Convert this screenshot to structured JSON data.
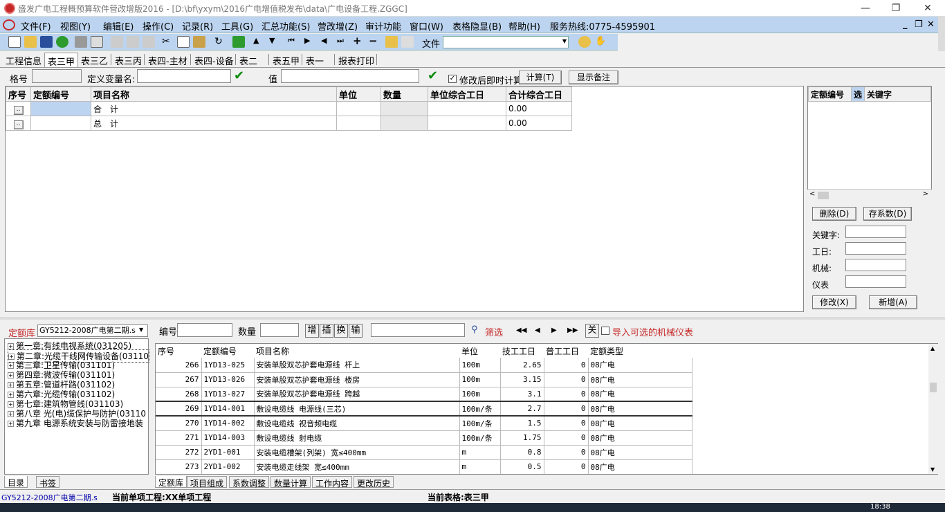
{
  "window": {
    "title": "盛发广电工程概预算软件营改增版2016 - [D:\\bf\\yxym\\2016广电增值税发布\\data\\广电设备工程.ZGGC]",
    "minimize": "—",
    "restore": "❐",
    "close": "✕"
  },
  "menu": [
    "文件(F)",
    "视图(Y)",
    "编辑(E)",
    "操作(C)",
    "记录(R)",
    "工具(G)",
    "汇总功能(S)",
    "营改增(Z)",
    "审计功能",
    "窗口(W)",
    "表格隐显(B)",
    "帮助(H)",
    "服务热线:0775-4595901"
  ],
  "toolbar": {
    "file_label": "文件"
  },
  "tabs": [
    "工程信息",
    "表三甲",
    "表三乙",
    "表三丙",
    "表四-主材",
    "表四-设备",
    "表二",
    "表五甲",
    "表一",
    "报表打印"
  ],
  "active_tab": "表三甲",
  "params": {
    "ge_label": "格号",
    "define_var_label": "定义变量名:",
    "value_label": "值",
    "recalc_label": "修改后即时计算",
    "calc_button": "计算(T)",
    "show_note_button": "显示备注"
  },
  "main_grid": {
    "columns": [
      "序号",
      "定额编号",
      "项目名称",
      "单位",
      "数量",
      "单位综合工日",
      "合计综合工日"
    ],
    "rows": [
      {
        "btn": "..",
        "name": "合　计",
        "total": "0.00"
      },
      {
        "btn": "..",
        "name": "总　计",
        "total": "0.00"
      }
    ]
  },
  "right_panel": {
    "columns": [
      "定额编号",
      "选",
      "关键字"
    ],
    "delete_button": "删除(D)",
    "save_coef_button": "存系数(D)",
    "keyword_label": "关键字:",
    "workday_label": "工日:",
    "machine_label": "机械:",
    "instrument_label": "仪表",
    "modify_button": "修改(X)",
    "add_button": "新增(A)"
  },
  "library": {
    "label": "定额库",
    "selected": "GY5212-2008广电第二期.s",
    "tree": [
      "第一章:有线电视系统(031205)",
      "第二章:光缆干线网传输设备(03110",
      "第三章:卫星传输(031101)",
      "第四章:微波传输(031101)",
      "第五章:管道杆路(031102)",
      "第六章:光缆传输(031102)",
      "第七章:建筑物管线(031103)",
      "第八章 光(电)缆保护与防护(03110",
      "第九章 电源系统安装与防雷接地装"
    ],
    "tabs": [
      "目录",
      "书签"
    ]
  },
  "search": {
    "code_label": "编号",
    "qty_label": "数量",
    "add": "增",
    "insert": "插",
    "swap": "换",
    "input": "输",
    "filter_label": "筛选",
    "first": "◀◀",
    "prev": "◀",
    "next": "▶",
    "last": "▶▶",
    "close": "关",
    "import_label": "导入可选的机械仪表"
  },
  "rate_table": {
    "columns": [
      "序号",
      "定额编号",
      "项目名称",
      "单位",
      "技工工日",
      "普工工日",
      "定额类型"
    ],
    "rows": [
      [
        "266",
        "1YD13-025",
        "安装单股双芯护套电源线 杆上",
        "100m",
        "2.65",
        "0",
        "08广电"
      ],
      [
        "267",
        "1YD13-026",
        "安装单股双芯护套电源线 楼房",
        "100m",
        "3.15",
        "0",
        "08广电"
      ],
      [
        "268",
        "1YD13-027",
        "安装单股双芯护套电源线 跨越",
        "100m",
        "3.1",
        "0",
        "08广电"
      ],
      [
        "269",
        "1YD14-001",
        "敷设电缆线 电源线(三芯)",
        "100m/条",
        "2.7",
        "0",
        "08广电"
      ],
      [
        "270",
        "1YD14-002",
        "敷设电缆线 视音频电缆",
        "100m/条",
        "1.5",
        "0",
        "08广电"
      ],
      [
        "271",
        "1YD14-003",
        "敷设电缆线 射电缆",
        "100m/条",
        "1.75",
        "0",
        "08广电"
      ],
      [
        "272",
        "2YD1-001",
        "安装电缆槽架(列架) 宽≤400mm",
        "m",
        "0.8",
        "0",
        "08广电"
      ],
      [
        "273",
        "2YD1-002",
        "安装电缆走线架 宽≤400mm",
        "m",
        "0.5",
        "0",
        "08广电"
      ]
    ],
    "tabs": [
      "定额库",
      "项目组成",
      "系数调整",
      "数量计算",
      "工作内容",
      "更改历史"
    ]
  },
  "status": {
    "library": "GY5212-2008广电第二期.s",
    "current_item": "当前单项工程:XX单项工程",
    "current_table": "当前表格:表三甲"
  },
  "clock": "18:38",
  "colors": {
    "menubar": "#bcd4ef",
    "accent_red": "#c62828",
    "selection": "#bcd4ef"
  }
}
